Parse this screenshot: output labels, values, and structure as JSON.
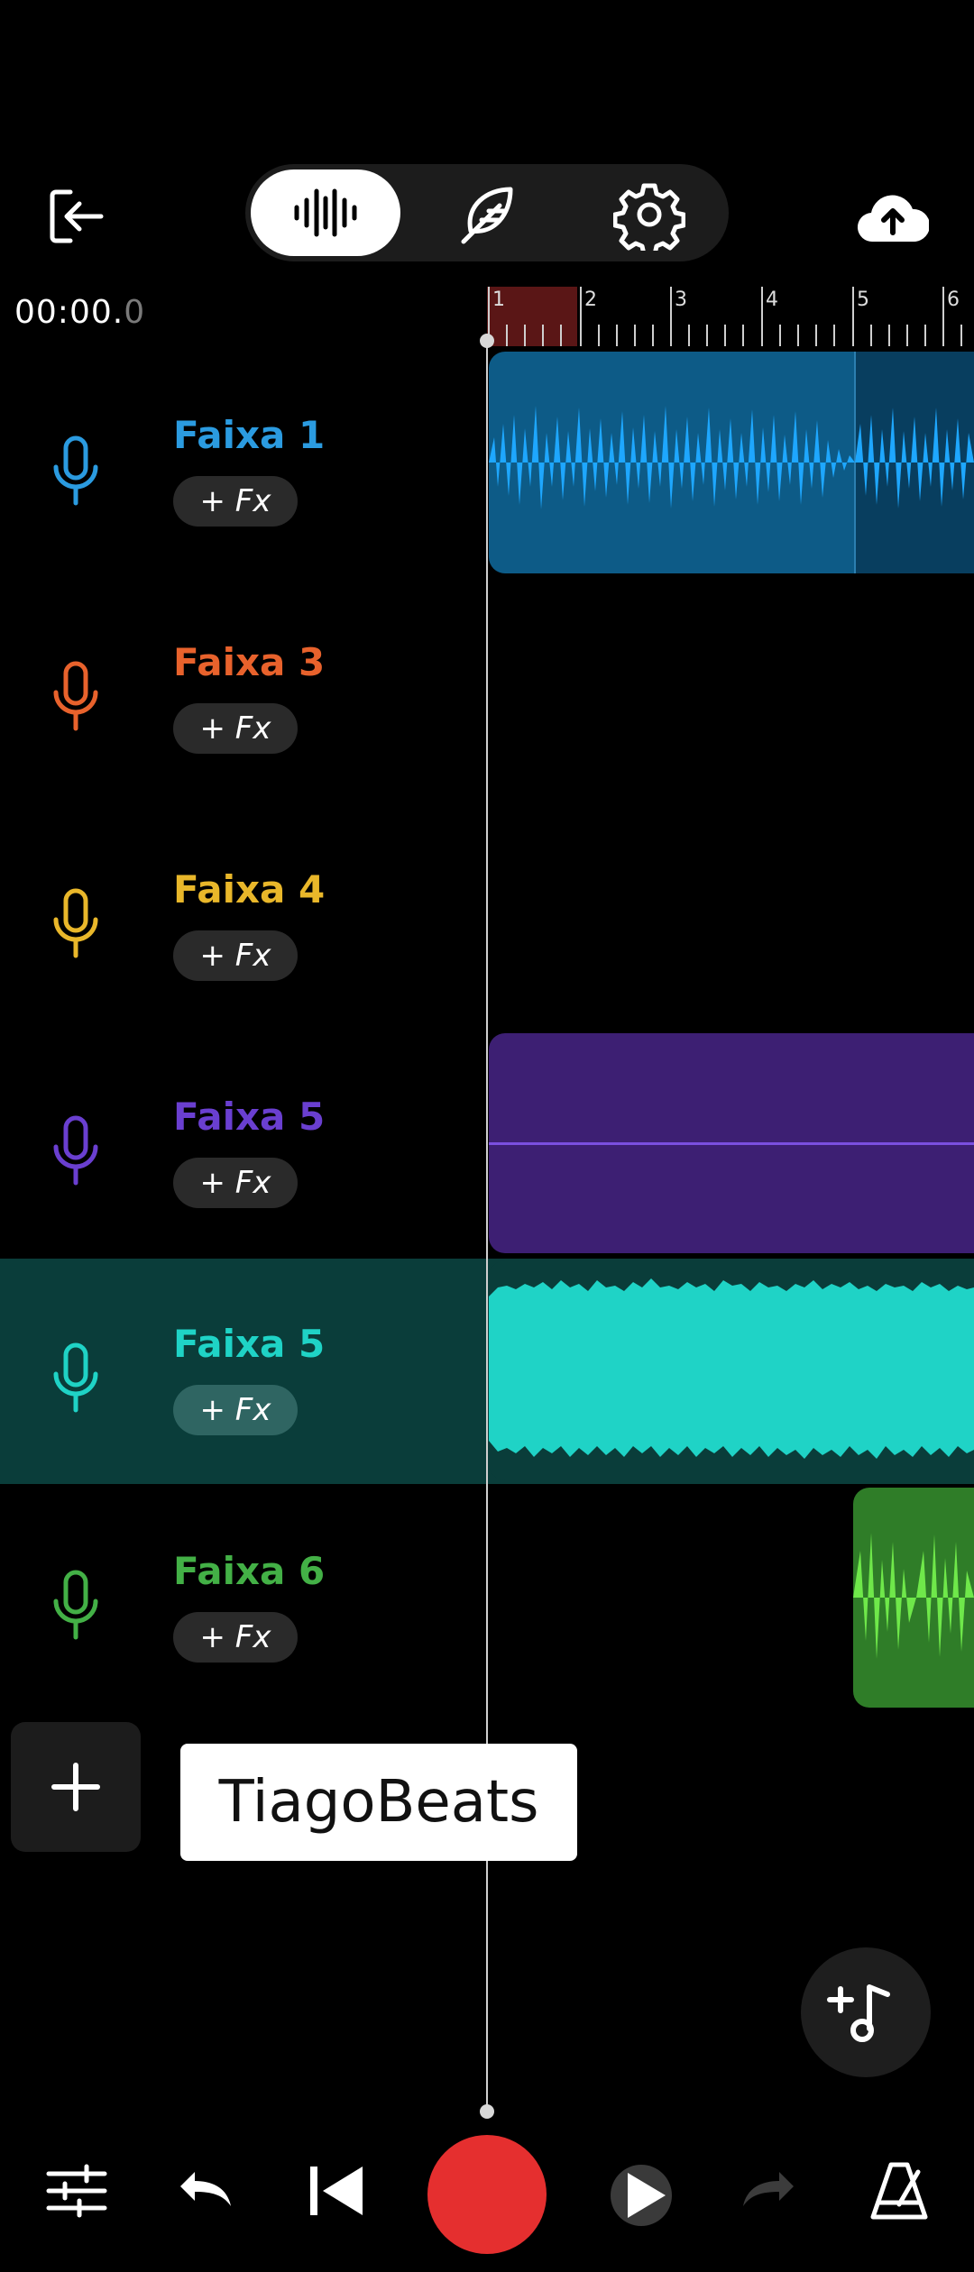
{
  "toolbar": {
    "exit_icon": "exit-icon",
    "modes": [
      "waveform-icon",
      "feather-icon",
      "gear-icon"
    ],
    "active_mode": "waveform-icon",
    "upload_icon": "cloud-upload-icon"
  },
  "timer": {
    "main": "00:00.",
    "fraction": "0"
  },
  "ruler": {
    "marks": [
      "1",
      "2",
      "3",
      "4",
      "5",
      "6"
    ]
  },
  "tracks": [
    {
      "name": "Faixa 1",
      "fx_label": "+ Fx",
      "color": "#2b9be0"
    },
    {
      "name": "Faixa 3",
      "fx_label": "+ Fx",
      "color": "#e8622c"
    },
    {
      "name": "Faixa 4",
      "fx_label": "+ Fx",
      "color": "#e9b72a"
    },
    {
      "name": "Faixa 5",
      "fx_label": "+ Fx",
      "color": "#6a3fd0"
    },
    {
      "name": "Faixa 5",
      "fx_label": "+ Fx",
      "color": "#1fd3c6"
    },
    {
      "name": "Faixa 6",
      "fx_label": "+ Fx",
      "color": "#43b046"
    }
  ],
  "watermark": "TiagoBeats",
  "colors": {
    "record": "#e52f2f",
    "clip1": "#0d5b87",
    "clip1_wave": "#1ea7ff",
    "clip5a": "#3d1f73",
    "clip5b": "#1fd3c6",
    "clip6": "#2f7d28"
  },
  "transport": [
    "mixer-icon",
    "undo-icon",
    "skip-back-icon",
    "record-button",
    "play-icon",
    "redo-icon",
    "metronome-icon"
  ]
}
